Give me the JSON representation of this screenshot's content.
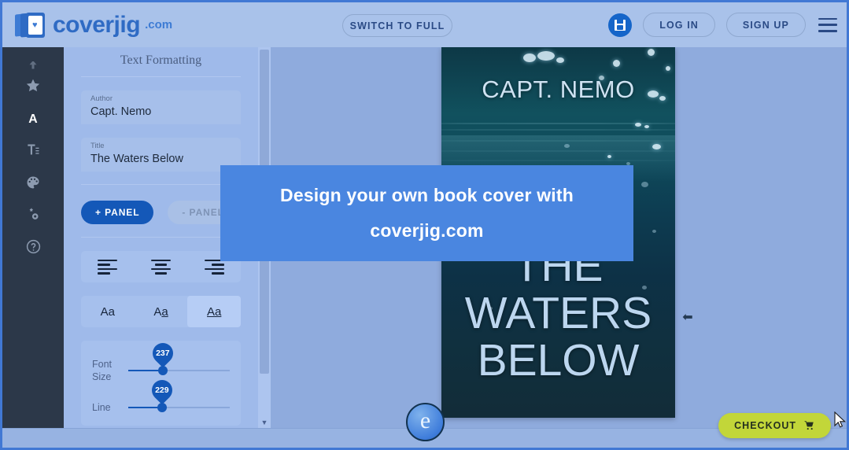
{
  "header": {
    "logo_text": "coverjig",
    "logo_suffix": ".com",
    "logo_icon": "book-heart-logo",
    "switch_label": "SWITCH TO FULL",
    "save_icon": "floppy-save-icon",
    "login_label": "LOG IN",
    "signup_label": "SIGN UP",
    "menu_icon": "hamburger-menu-icon"
  },
  "rail": {
    "items": [
      {
        "icon": "upload-icon",
        "label": ""
      },
      {
        "icon": "star-icon",
        "label": ""
      },
      {
        "icon": "text-letter-a-icon",
        "label": ""
      },
      {
        "icon": "text-formatting-icon",
        "label": ""
      },
      {
        "icon": "palette-icon",
        "label": ""
      },
      {
        "icon": "settings-gears-icon",
        "label": ""
      },
      {
        "icon": "help-question-icon",
        "label": ""
      }
    ]
  },
  "panel": {
    "title": "Text Formatting",
    "author_field": {
      "label": "Author",
      "value": "Capt. Nemo"
    },
    "title_field": {
      "label": "Title",
      "value": "The Waters Below"
    },
    "add_panel_label": "+ PANEL",
    "remove_panel_label": "- PANEL",
    "align_options": [
      {
        "icon": "align-left-icon",
        "selected": false
      },
      {
        "icon": "align-center-icon",
        "selected": false
      },
      {
        "icon": "align-right-icon",
        "selected": false
      }
    ],
    "case_options": [
      {
        "label": "Aa",
        "icon": "text-none-icon",
        "selected": false
      },
      {
        "label": "Aa",
        "icon": "text-underline-partial-icon",
        "selected": false
      },
      {
        "label": "Aa",
        "icon": "text-underline-icon",
        "selected": true
      }
    ],
    "sliders": [
      {
        "label": "Font Size",
        "value": "237",
        "percent": 34
      },
      {
        "label": "Line",
        "value": "229",
        "percent": 33
      }
    ],
    "scrollbar_icon": "scroll-down-arrow-icon"
  },
  "cover": {
    "author": "CAPT. NEMO",
    "title_line1": "THE",
    "title_line2": "WATERS",
    "title_line3": "BELOW",
    "collapse_icon": "arrow-left-icon"
  },
  "promo": {
    "line1": "Design your own book cover with",
    "line2": "coverjig.com"
  },
  "footer": {
    "browser_icon": "internet-explorer-e-icon",
    "checkout_label": "CHECKOUT",
    "cart_icon": "shopping-cart-icon"
  },
  "colors": {
    "brand_blue": "#2f6bc4",
    "accent_blue": "#1458b8",
    "promo_blue": "#4a86e0",
    "canvas_blue": "#8fabdd",
    "panel_blue": "#9fbaea",
    "rail_dark": "#2c3849",
    "checkout_green": "#c2d639"
  }
}
